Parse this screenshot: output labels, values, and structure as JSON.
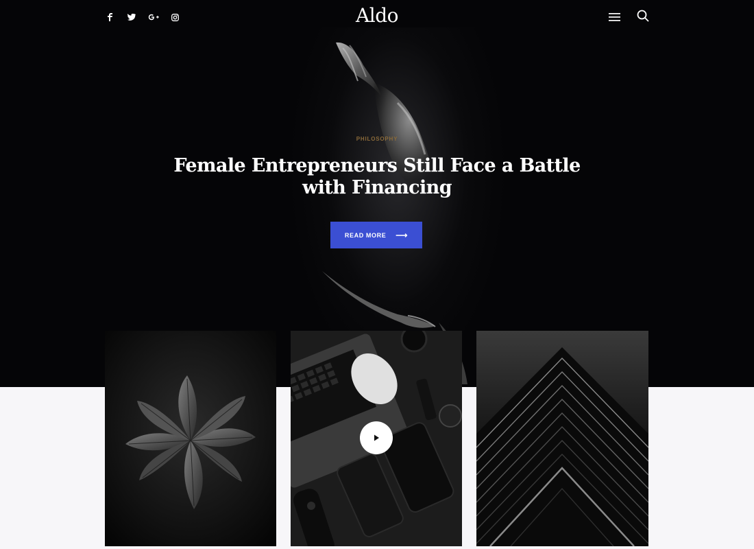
{
  "header": {
    "logo": "Aldo",
    "social": [
      {
        "name": "facebook-icon",
        "glyph": "f"
      },
      {
        "name": "twitter-icon",
        "glyph": "🐦"
      },
      {
        "name": "google-plus-icon",
        "glyph": "G+"
      },
      {
        "name": "instagram-icon",
        "glyph": "◎"
      }
    ]
  },
  "hero": {
    "category": "PHILOSOPHY",
    "title": "Female Entrepreneurs Still Face a Battle with Financing",
    "button_label": "READ MORE",
    "button_arrow": "⟶"
  },
  "colors": {
    "accent": "#3b4fd3",
    "hero_bg": "#050507",
    "page_bg": "#f7f6f9",
    "category": "#8a6a3a"
  },
  "cards": [
    {
      "image": "dark leaf plant photo"
    },
    {
      "image": "laptop, phones and watch flatlay photo",
      "has_play": true
    },
    {
      "image": "dark architecture photo"
    }
  ]
}
